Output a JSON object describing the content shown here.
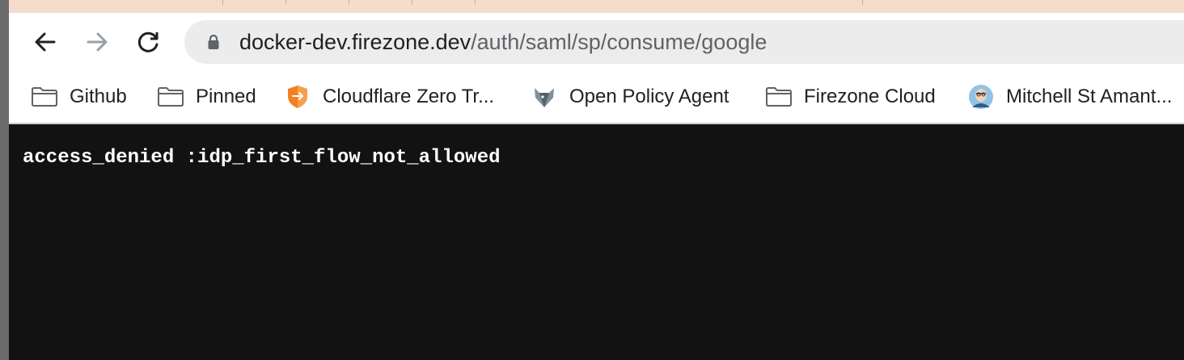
{
  "browser": {
    "url_host": "docker-dev.firezone.dev",
    "url_path": "/auth/saml/sp/consume/google",
    "nav": {
      "back": "back",
      "forward": "forward",
      "reload": "reload"
    }
  },
  "bookmarks": [
    {
      "label": "Github",
      "icon": "folder-icon"
    },
    {
      "label": "Pinned",
      "icon": "folder-icon"
    },
    {
      "label": "Cloudflare Zero Tr...",
      "icon": "cloudflare-shield-icon"
    },
    {
      "label": "Open Policy Agent",
      "icon": "opa-icon"
    },
    {
      "label": "Firezone Cloud",
      "icon": "folder-icon"
    },
    {
      "label": "Mitchell St Amant...",
      "icon": "avatar-icon"
    }
  ],
  "page": {
    "message": "access_denied :idp_first_flow_not_allowed"
  },
  "colors": {
    "tab_strip": "#f6dccd",
    "page_background": "#121212",
    "message_text": "#ffffff"
  }
}
